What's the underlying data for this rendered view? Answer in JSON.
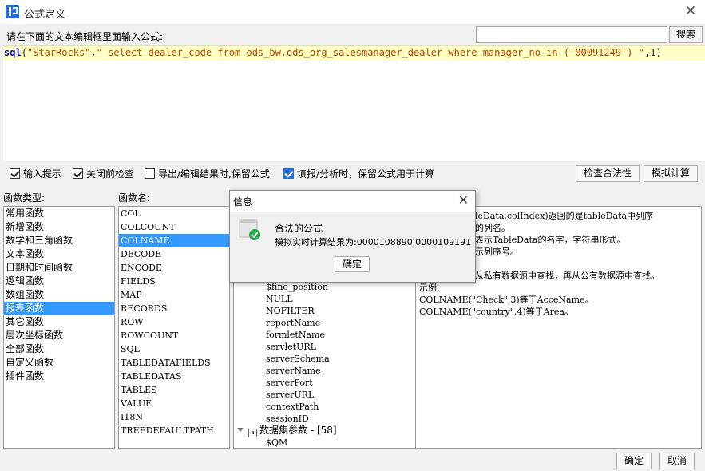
{
  "window": {
    "title": "公式定义",
    "close_glyph": "✕"
  },
  "editor_prompt": "请在下面的文本编辑框里面输入公式:",
  "search": {
    "value": "",
    "button_label": "搜索"
  },
  "formula": {
    "func": "sql",
    "open": "(",
    "arg1": "\"StarRocks\"",
    "comma1": ",",
    "arg2": "\" select dealer_code from ods_bw.ods_org_salesmanager_dealer where manager_no in ('00091249') \"",
    "comma2": ",",
    "arg3": "1",
    "close": ")"
  },
  "options": [
    {
      "label": "输入提示",
      "checked": true
    },
    {
      "label": "关闭前检查",
      "checked": true
    },
    {
      "label": "导出/编辑结果时,保留公式",
      "checked": false
    },
    {
      "label": "填报/分析时，保留公式用于计算",
      "checked": true
    }
  ],
  "buttons": {
    "check_validity": "检查合法性",
    "simulate": "模拟计算",
    "ok": "确定",
    "cancel": "取消"
  },
  "func_types": {
    "label": "函数类型:",
    "items": [
      "常用函数",
      "新增函数",
      "数学和三角函数",
      "文本函数",
      "日期和时间函数",
      "逻辑函数",
      "数组函数",
      "报表函数",
      "其它函数",
      "层次坐标函数",
      "全部函数",
      "自定义函数",
      "插件函数"
    ],
    "selected": 7
  },
  "func_names": {
    "label": "函数名:",
    "items": [
      "COL",
      "COLCOUNT",
      "COLNAME",
      "DECODE",
      "ENCODE",
      "FIELDS",
      "MAP",
      "RECORDS",
      "ROW",
      "ROWCOUNT",
      "SQL",
      "TABLEDATAFIELDS",
      "TABLEDATAS",
      "TABLES",
      "VALUE",
      "I18N",
      "TREEDEFAULTPATH"
    ],
    "selected": 2
  },
  "params_tree": {
    "items": [
      "$fine_position",
      "NULL",
      "NOFILTER",
      "reportName",
      "formletName",
      "servletURL",
      "serverSchema",
      "serverName",
      "serverPort",
      "serverURL",
      "contextPath",
      "sessionID"
    ],
    "group": "数据集参数 - [58]",
    "group_child": "$QM"
  },
  "description": {
    "lines": [
      "leData,colIndex)返回的是tableData中列序",
      "的列名。",
      "表示TableData的名字，字符串形式。",
      "示列序号。",
      "",
      "从私有数据源中查找，再从公有数据源中查找。",
      "示例:",
      "COLNAME(\"Check\",3)等于AcceName。",
      "COLNAME(\"country\",4)等于Area。"
    ]
  },
  "dialog": {
    "title": "信息",
    "message": "合法的公式",
    "result": "模拟实时计算结果为:0000108890,0000109191",
    "ok_label": "确定",
    "close_glyph": "✕"
  }
}
